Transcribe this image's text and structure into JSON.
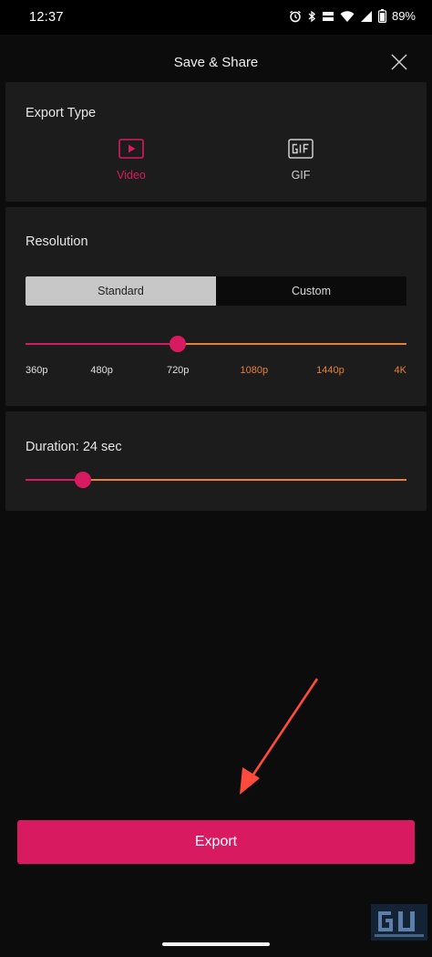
{
  "status_bar": {
    "time": "12:37",
    "battery": "89%",
    "icons": [
      "alarm-icon",
      "bluetooth-icon",
      "volte-icon",
      "wifi-icon",
      "signal-icon",
      "battery-icon"
    ]
  },
  "header": {
    "title": "Save & Share",
    "close_icon": "close-icon"
  },
  "export_type": {
    "label": "Export Type",
    "options": [
      {
        "label": "Video",
        "icon": "video-play-icon",
        "selected": true
      },
      {
        "label": "GIF",
        "icon": "gif-icon",
        "selected": false
      }
    ]
  },
  "resolution": {
    "label": "Resolution",
    "modes": [
      {
        "label": "Standard",
        "selected": true
      },
      {
        "label": "Custom",
        "selected": false
      }
    ],
    "ticks": [
      {
        "label": "360p",
        "available": true
      },
      {
        "label": "480p",
        "available": true
      },
      {
        "label": "720p",
        "available": true
      },
      {
        "label": "1080p",
        "available": false
      },
      {
        "label": "1440p",
        "available": false
      },
      {
        "label": "4K",
        "available": false
      }
    ],
    "selected": "720p",
    "selected_index": 2
  },
  "duration": {
    "label": "Duration: 24 sec",
    "level": 0.15
  },
  "export_button": {
    "label": "Export"
  },
  "colors": {
    "accent": "#d81b60",
    "unavailable": "#e8803a",
    "card": "#1c1c1c",
    "annotation_arrow": "#ff4a3d"
  }
}
